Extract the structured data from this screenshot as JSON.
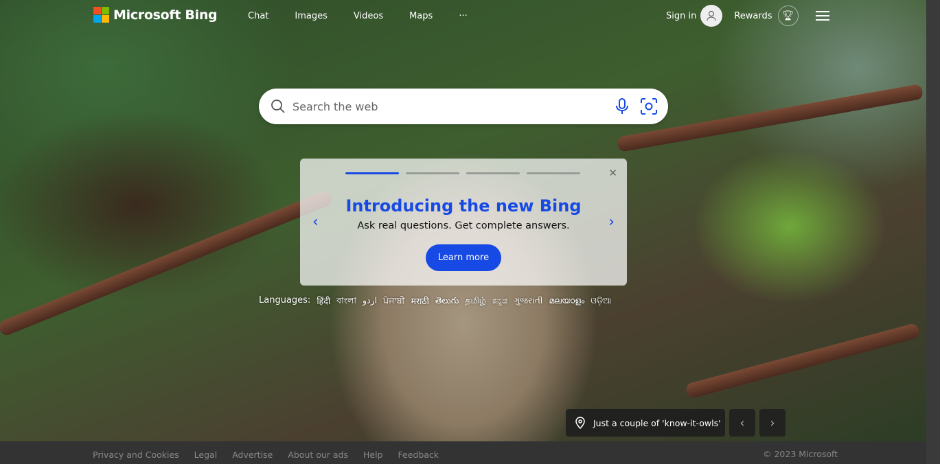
{
  "header": {
    "logo_text": "Microsoft Bing",
    "nav": [
      "Chat",
      "Images",
      "Videos",
      "Maps",
      "···"
    ],
    "sign_in": "Sign in",
    "rewards": "Rewards"
  },
  "search": {
    "placeholder": "Search the web"
  },
  "promo": {
    "title": "Introducing the new Bing",
    "subtitle": "Ask real questions. Get complete answers.",
    "button": "Learn more",
    "slide": 1,
    "slides": 4
  },
  "languages": {
    "label": "Languages:",
    "items": [
      "हिंदी",
      "বাংলা",
      "اردو",
      "ਪੰਜਾਬੀ",
      "मराठी",
      "తెలుగు",
      "தமிழ்",
      "ಕನ್ನಡ",
      "ગુજરાતી",
      "മലയാളം",
      "ଓଡ଼ିଆ"
    ]
  },
  "image_caption": "Just a couple of 'know-it-owls'",
  "footer": {
    "links": [
      "Privacy and Cookies",
      "Legal",
      "Advertise",
      "About our ads",
      "Help",
      "Feedback"
    ],
    "copyright": "© 2023 Microsoft"
  },
  "colors": {
    "accent": "#174ae4"
  }
}
